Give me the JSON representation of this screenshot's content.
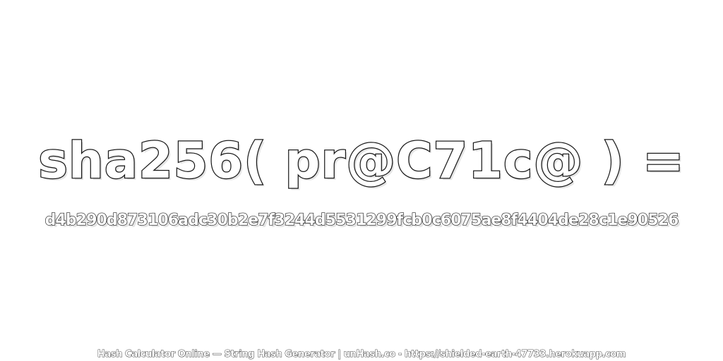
{
  "expression": "sha256( pr@C71c@ ) =",
  "hash": "d4b290d873106adc30b2e7f3244d5531299fcb0c6075ae8f4404de28c1e90526",
  "footer": "Hash Calculator Online — String Hash Generator | unHash.co - https://shielded-earth-47733.herokuapp.com",
  "colors": {
    "background": "#ffffff",
    "text_fill": "#ffffff",
    "text_outline": "#1a1a1a"
  }
}
